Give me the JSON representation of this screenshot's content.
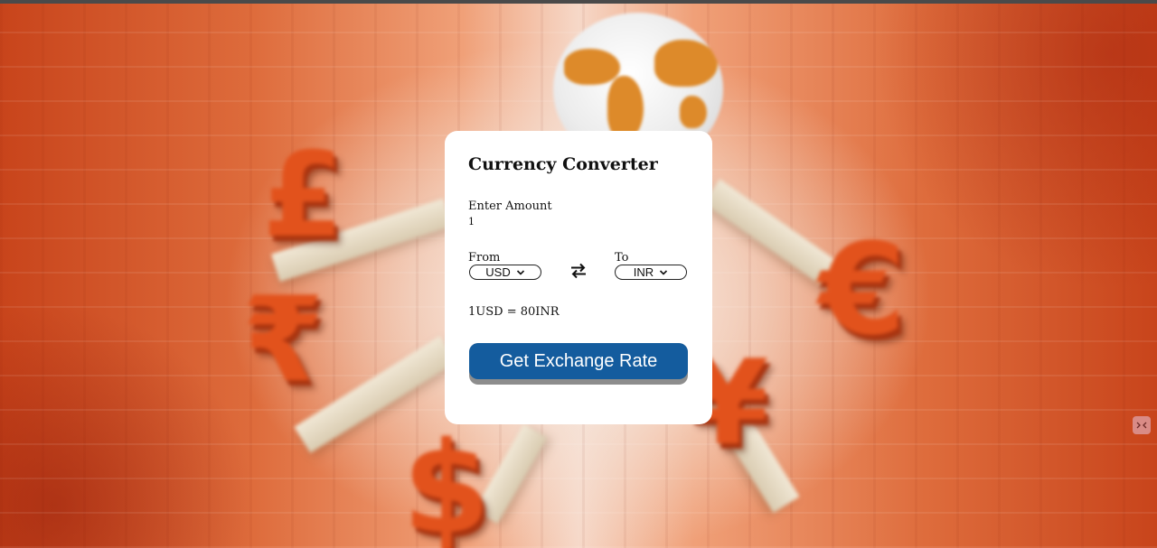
{
  "converter": {
    "title": "Currency Converter",
    "amount_label": "Enter Amount",
    "amount_value": "1",
    "from_label": "From",
    "to_label": "To",
    "from_currency": "USD",
    "to_currency": "INR",
    "rate_text": "1USD = 80INR",
    "button_label": "Get Exchange Rate",
    "swap_icon": "swap-arrows-icon",
    "dropdown_icon": "chevron-down-icon"
  },
  "background": {
    "symbols": [
      "£",
      "€",
      "₹",
      "$",
      "¥"
    ]
  },
  "colors": {
    "button": "#145c9e",
    "button_shadow": "#8d8d8d",
    "card": "#ffffff",
    "background_orange": "#de6c3c",
    "corner_widget": "#d98b86"
  }
}
